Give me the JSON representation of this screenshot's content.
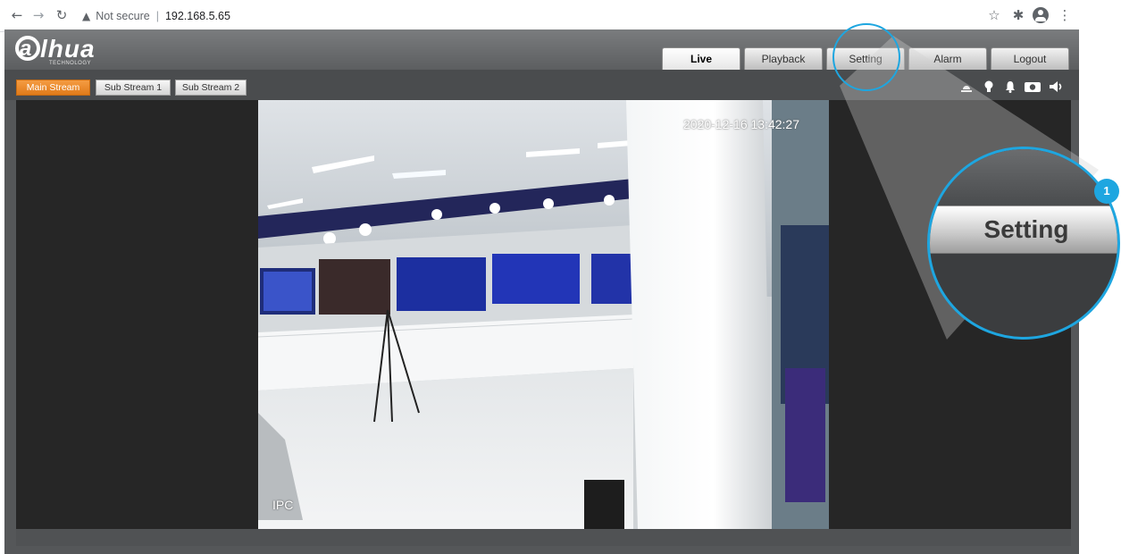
{
  "browser": {
    "back_icon": "arrow-left-icon",
    "forward_icon": "arrow-right-icon",
    "reload_icon": "reload-icon",
    "security_label": "Not secure",
    "url": "192.168.5.65",
    "bookmark_icon": "star-icon",
    "extensions_icon": "puzzle-icon",
    "profile_icon": "account-icon",
    "menu_icon": "more-vertical-icon"
  },
  "app": {
    "logo": "alhua",
    "logo_sub": "TECHNOLOGY",
    "tabs": [
      {
        "label": "Live",
        "active": true
      },
      {
        "label": "Playback",
        "active": false
      },
      {
        "label": "Setting",
        "active": false
      },
      {
        "label": "Alarm",
        "active": false
      },
      {
        "label": "Logout",
        "active": false
      }
    ],
    "streams": [
      {
        "label": "Main Stream",
        "active": true
      },
      {
        "label": "Sub Stream 1",
        "active": false
      },
      {
        "label": "Sub Stream 2",
        "active": false
      }
    ],
    "toolbar_icons": [
      "alarm-light-icon",
      "bulb-icon",
      "bell-icon",
      "camera-icon",
      "speaker-icon"
    ],
    "video": {
      "timestamp": "2020-12-16 13:42:27",
      "channel_name": "IPC"
    }
  },
  "callout": {
    "badge": "1",
    "label": "Setting"
  },
  "colors": {
    "accent": "#1ea6e0",
    "active_stream": "#f08a24",
    "header": "#5c5e60"
  }
}
